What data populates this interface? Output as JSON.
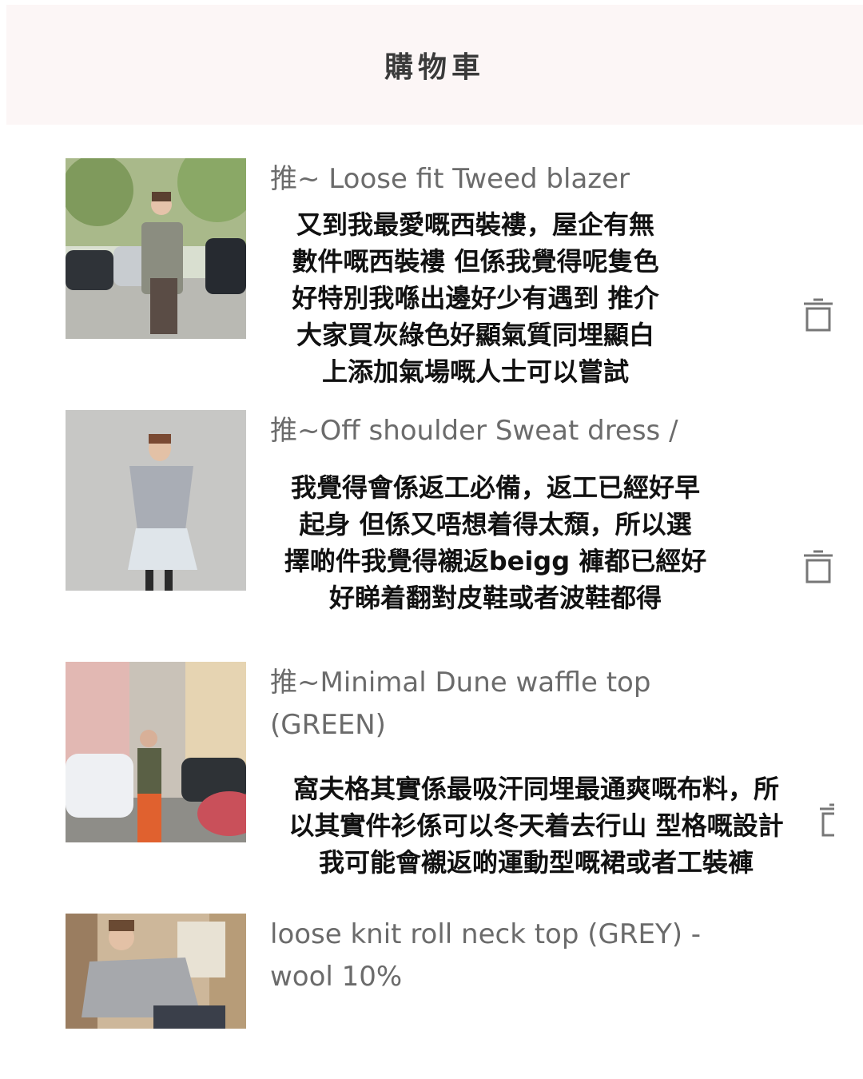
{
  "header": {
    "title": "購物車"
  },
  "items": [
    {
      "name": "推~ Loose fit Tweed blazer",
      "note": "又到我最愛嘅西裝褸，屋企有無\n數件嘅西裝褸 但係我覺得呢隻色\n好特別我喺出邊好少有遇到 推介\n大家買灰綠色好顯氣質同埋顯白\n上添加氣場嘅人士可以嘗試",
      "image": "street-photo-woman-in-tweed-blazer"
    },
    {
      "name": "推~Off shoulder Sweat dress /",
      "note": "我覺得會係返工必備，返工已經好早\n起身 但係又唔想着得太頹，所以選\n擇啲件我覺得襯返beigg 褲都已經好\n好睇着翻對皮鞋或者波鞋都得",
      "image": "studio-photo-woman-in-grey-sweat-dress"
    },
    {
      "name": "推~Minimal Dune waffle top\n(GREEN)",
      "note": "窩夫格其實係最吸汗同埋最通爽嘅布料，所\n以其實件衫係可以冬天着去行山 型格嘅設計\n我可能會襯返啲運動型嘅裙或者工裝褲",
      "image": "street-photo-woman-in-green-top-orange-pants"
    },
    {
      "name": "loose knit roll neck top (GREY) -\nwool 10%",
      "image": "indoor-photo-woman-in-grey-knit-top"
    }
  ],
  "icons": {
    "delete": "trash-icon"
  },
  "colors": {
    "header_bg": "#fcf6f6",
    "name_text": "#6b6b6b",
    "icon": "#777777"
  }
}
